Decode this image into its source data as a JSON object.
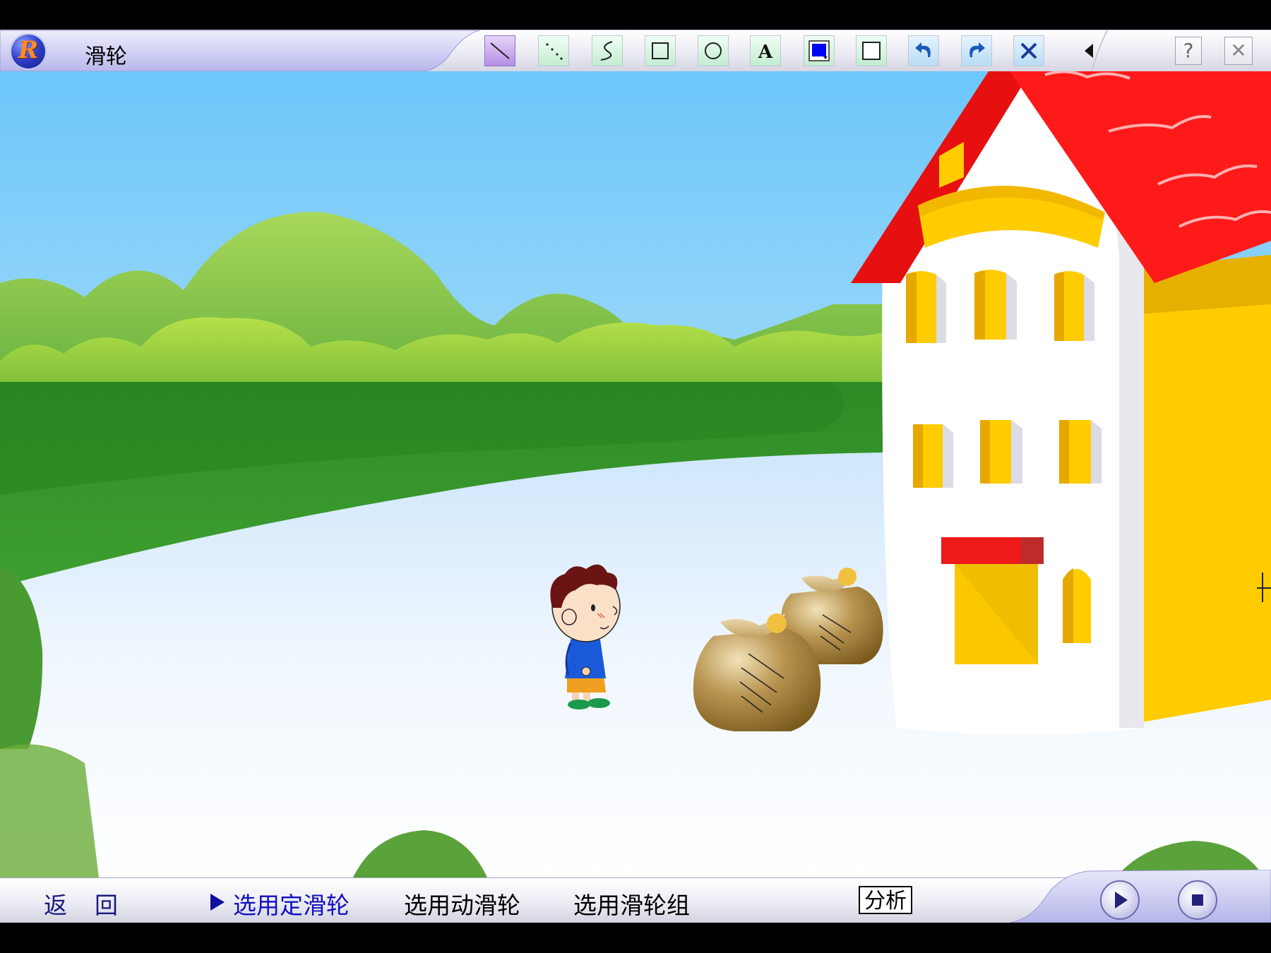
{
  "window": {
    "title": "滑轮",
    "logo_letter": "R"
  },
  "toolbar": {
    "tools": [
      {
        "name": "line-tool",
        "icon": "diagonal-line-icon"
      },
      {
        "name": "dotted-line-tool",
        "icon": "dotted-line-icon"
      },
      {
        "name": "freehand-tool",
        "icon": "freehand-curve-icon"
      },
      {
        "name": "rectangle-tool",
        "icon": "square-icon"
      },
      {
        "name": "ellipse-tool",
        "icon": "circle-icon"
      },
      {
        "name": "text-tool",
        "icon": "text-a-icon",
        "label": "A"
      },
      {
        "name": "line-color-tool",
        "icon": "color-picker-icon"
      },
      {
        "name": "fill-color-tool",
        "icon": "fill-square-icon"
      },
      {
        "name": "undo-tool",
        "icon": "undo-icon"
      },
      {
        "name": "redo-tool",
        "icon": "redo-icon"
      },
      {
        "name": "clear-tool",
        "icon": "close-x-icon"
      },
      {
        "name": "collapse-toolbar",
        "icon": "triangle-left-icon"
      }
    ],
    "help_label": "?",
    "close_label": "✕",
    "colors": {
      "accent": "#0000ff",
      "undo": "#1a5ab8"
    }
  },
  "nav": {
    "back_1": "返",
    "back_2": "回",
    "fixed_pulley": "选用定滑轮",
    "movable_pulley": "选用动滑轮",
    "pulley_block": "选用滑轮组",
    "analyze": "分析",
    "active_item": "fixed_pulley"
  },
  "media": {
    "play": "play-icon",
    "stop": "stop-icon"
  },
  "scene": {
    "sky": "#6fc8f8",
    "roof": "#ff1a1a",
    "wall": "#ffcc00",
    "grass": "#2e8a2a",
    "bag": "#9a7830"
  }
}
